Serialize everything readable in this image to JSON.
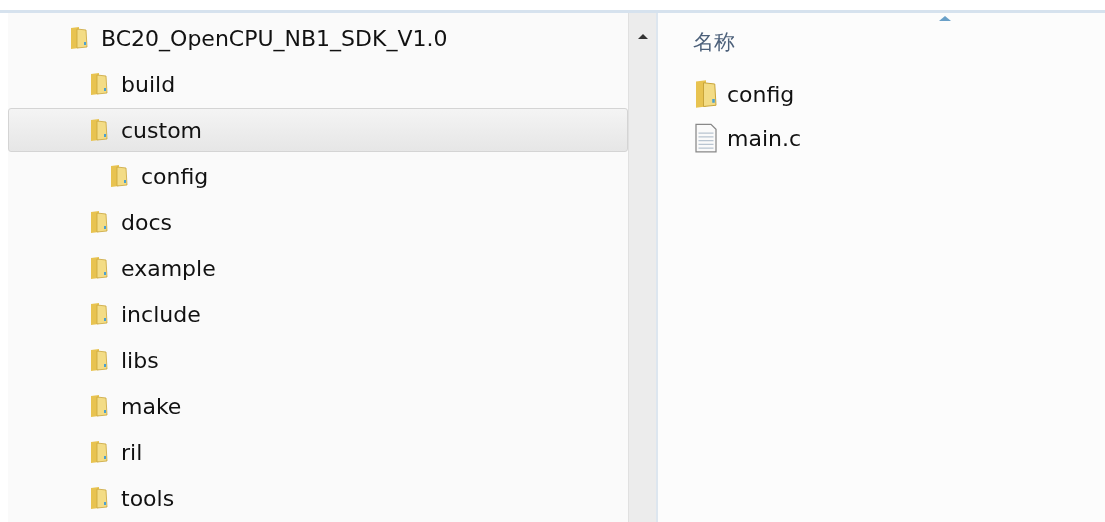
{
  "tree": [
    {
      "label": "BC20_OpenCPU_NB1_SDK_V1.0",
      "selected": false,
      "children": [
        {
          "label": "build",
          "selected": false
        },
        {
          "label": "custom",
          "selected": true,
          "children": [
            {
              "label": "config",
              "selected": false
            }
          ]
        },
        {
          "label": "docs",
          "selected": false
        },
        {
          "label": "example",
          "selected": false
        },
        {
          "label": "include",
          "selected": false
        },
        {
          "label": "libs",
          "selected": false
        },
        {
          "label": "make",
          "selected": false
        },
        {
          "label": "ril",
          "selected": false
        },
        {
          "label": "tools",
          "selected": false
        }
      ]
    }
  ],
  "list": {
    "column_header": "名称",
    "items": [
      {
        "name": "config",
        "kind": "folder"
      },
      {
        "name": "main.c",
        "kind": "file"
      }
    ]
  }
}
